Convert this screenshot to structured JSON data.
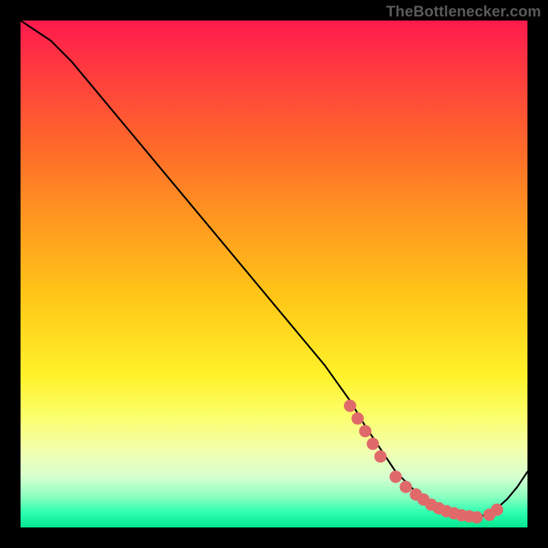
{
  "attribution": "TheBottlenecker.com",
  "chart_data": {
    "type": "line",
    "title": "",
    "xlabel": "",
    "ylabel": "",
    "xlim": [
      0,
      100
    ],
    "ylim": [
      0,
      100
    ],
    "series": [
      {
        "name": "bottleneck-curve",
        "x": [
          0,
          6,
          10,
          20,
          30,
          40,
          50,
          60,
          65,
          68,
          70,
          72,
          74,
          76,
          78,
          80,
          82,
          84,
          86,
          88,
          90,
          92,
          94,
          96,
          98,
          100
        ],
        "values": [
          100,
          96,
          92,
          80,
          68,
          56,
          44,
          32,
          25,
          20,
          17,
          14,
          11,
          9,
          7,
          5,
          4,
          3,
          2.4,
          2,
          2,
          2.6,
          3.8,
          5.6,
          8.0,
          11
        ]
      }
    ],
    "markers": {
      "name": "highlight-dots",
      "points": [
        {
          "x": 65.0,
          "y": 24.0
        },
        {
          "x": 66.5,
          "y": 21.5
        },
        {
          "x": 68.0,
          "y": 19.0
        },
        {
          "x": 69.5,
          "y": 16.5
        },
        {
          "x": 71.0,
          "y": 14.0
        },
        {
          "x": 74.0,
          "y": 10.0
        },
        {
          "x": 76.0,
          "y": 8.0
        },
        {
          "x": 78.0,
          "y": 6.5
        },
        {
          "x": 79.5,
          "y": 5.5
        },
        {
          "x": 81.0,
          "y": 4.5
        },
        {
          "x": 82.5,
          "y": 3.8
        },
        {
          "x": 84.0,
          "y": 3.2
        },
        {
          "x": 85.5,
          "y": 2.8
        },
        {
          "x": 87.0,
          "y": 2.4
        },
        {
          "x": 88.5,
          "y": 2.2
        },
        {
          "x": 90.0,
          "y": 2.0
        },
        {
          "x": 92.5,
          "y": 2.5
        },
        {
          "x": 94.0,
          "y": 3.5
        }
      ],
      "color": "#e06a6a",
      "radius": 9
    },
    "colors": {
      "line": "#000000",
      "gradient_top": "#ff1a4d",
      "gradient_mid": "#fff22a",
      "gradient_bottom": "#04e58e"
    }
  }
}
